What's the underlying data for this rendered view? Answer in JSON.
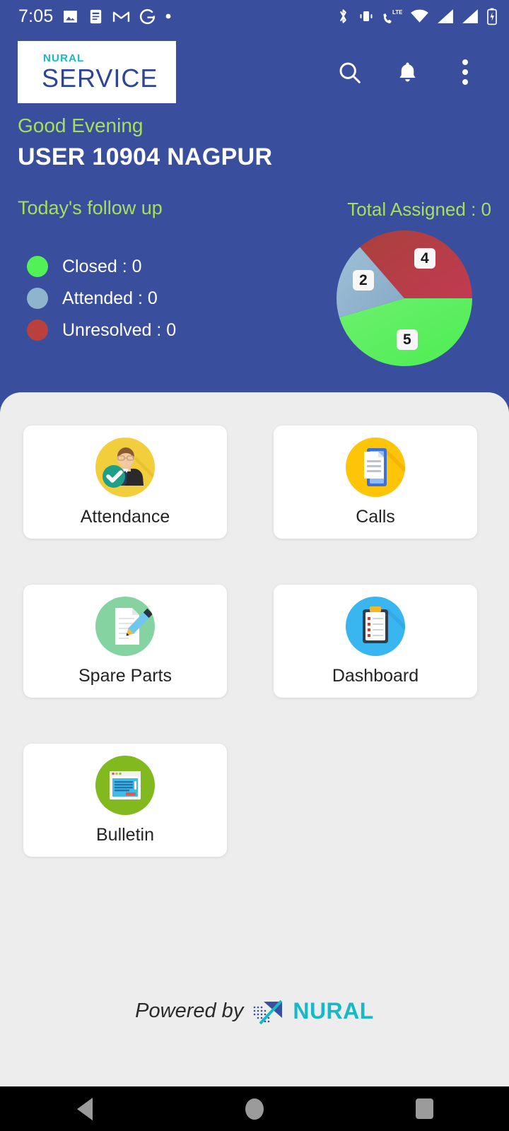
{
  "status_bar": {
    "time": "7:05",
    "left_icons": [
      "image-icon",
      "article-icon",
      "gmail-icon",
      "google-icon",
      "dot-icon"
    ],
    "right_icons": [
      "bluetooth-icon",
      "vibrate-icon",
      "lte-call-icon",
      "wifi-icon",
      "signal-icon",
      "signal-icon-2",
      "battery-icon"
    ]
  },
  "app_bar": {
    "logo_top": "NURAL",
    "logo_main": "SERVICE",
    "actions": [
      {
        "name": "search-icon",
        "label": "Search"
      },
      {
        "name": "notifications-icon",
        "label": "Notifications"
      },
      {
        "name": "overflow-menu-icon",
        "label": "More options"
      }
    ]
  },
  "greeting": {
    "salutation": "Good Evening",
    "user": "USER 10904  NAGPUR"
  },
  "followup": {
    "title": "Today's follow up",
    "total_assigned": "Total Assigned : 0",
    "legend": [
      {
        "label": "Closed : 0",
        "color": "#52f157"
      },
      {
        "label": "Attended : 0",
        "color": "#8fb4cd"
      },
      {
        "label": "Unresolved : 0",
        "color": "#b9403c"
      }
    ]
  },
  "chart_data": {
    "type": "pie",
    "title": "Total Assigned : 0",
    "categories": [
      "Closed",
      "Attended",
      "Unresolved"
    ],
    "values": [
      5,
      2,
      4
    ],
    "labels": [
      "5",
      "2",
      "4"
    ],
    "colors": [
      "#5cf05f",
      "#8fb4cd",
      "#b2403f"
    ],
    "total": 11,
    "legend_position": "left",
    "grid": false
  },
  "tiles": [
    {
      "label": "Attendance",
      "icon": "attendance-icon",
      "icon_bg": "#f2ce3c"
    },
    {
      "label": "Calls",
      "icon": "calls-icon",
      "icon_bg": "#fdc408"
    },
    {
      "label": "Spare Parts",
      "icon": "spare-parts-icon",
      "icon_bg": "#84d3a0"
    },
    {
      "label": "Dashboard",
      "icon": "dashboard-icon",
      "icon_bg": "#39b5ef"
    },
    {
      "label": "Bulletin",
      "icon": "bulletin-icon",
      "icon_bg": "#81b91f"
    }
  ],
  "footer": {
    "powered_by": "Powered by",
    "brand": "NURAL",
    "logo_mark_colors": {
      "triangle": "#3a4e9e",
      "accent": "#17b9c6"
    }
  },
  "nav_bar": {
    "buttons": [
      {
        "name": "nav-back-button",
        "label": "Back"
      },
      {
        "name": "nav-home-button",
        "label": "Home"
      },
      {
        "name": "nav-recents-button",
        "label": "Recents"
      }
    ]
  },
  "colors": {
    "header_blue": "#3a4e9e",
    "accent_green": "#a6e05a",
    "sheet_bg": "#ededed",
    "brand_cyan": "#17b9c6"
  }
}
